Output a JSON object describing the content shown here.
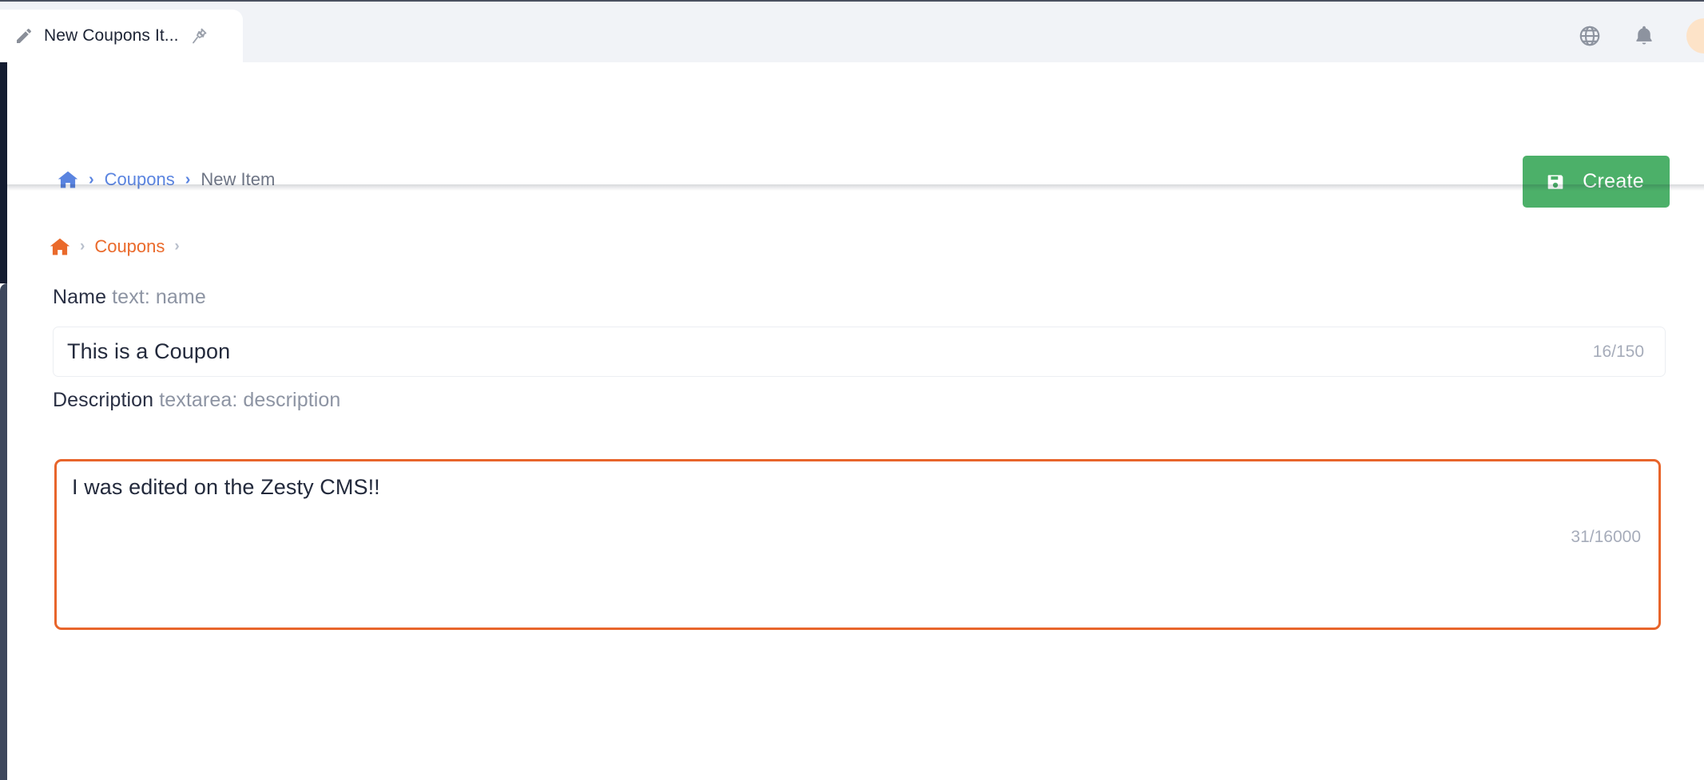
{
  "window": {
    "tab": {
      "title": "New Coupons It...",
      "edit_icon": "pencil-icon",
      "pin_icon": "pin-icon"
    },
    "actions": {
      "language_icon": "globe-icon",
      "notifications_icon": "bell-icon",
      "avatar": "user-avatar"
    }
  },
  "toolbar": {
    "breadcrumb": {
      "home_icon": "home-icon",
      "separator": "›",
      "items": [
        {
          "label": "Coupons",
          "style": "link"
        },
        {
          "label": "New Item",
          "style": "plain"
        }
      ]
    },
    "create_label": "Create",
    "create_icon": "save-icon",
    "create_color": "#4cb069"
  },
  "content": {
    "breadcrumb": {
      "home_icon": "home-icon",
      "separator": "›",
      "items": [
        {
          "label": "Coupons",
          "style": "link-orange"
        }
      ]
    },
    "fields": [
      {
        "name": "name",
        "label": "Name",
        "meta": "text: name",
        "value": "This is a Coupon",
        "placeholder": "",
        "counter": "16/150",
        "chars_used": 16,
        "chars_max": 150,
        "focused": false
      },
      {
        "name": "description",
        "label": "Description",
        "meta": "textarea: description",
        "value": "I was edited on the Zesty CMS!!",
        "placeholder": "",
        "counter": "31/16000",
        "chars_used": 31,
        "chars_max": 16000,
        "focused": true
      }
    ]
  },
  "colors": {
    "accent_orange": "#e8652b",
    "accent_blue": "#5a84e0",
    "success_green": "#4cb069",
    "rail_dark": "#141c30",
    "rail_light": "#3d475c",
    "tabstrip_bg": "#f1f3f7"
  }
}
